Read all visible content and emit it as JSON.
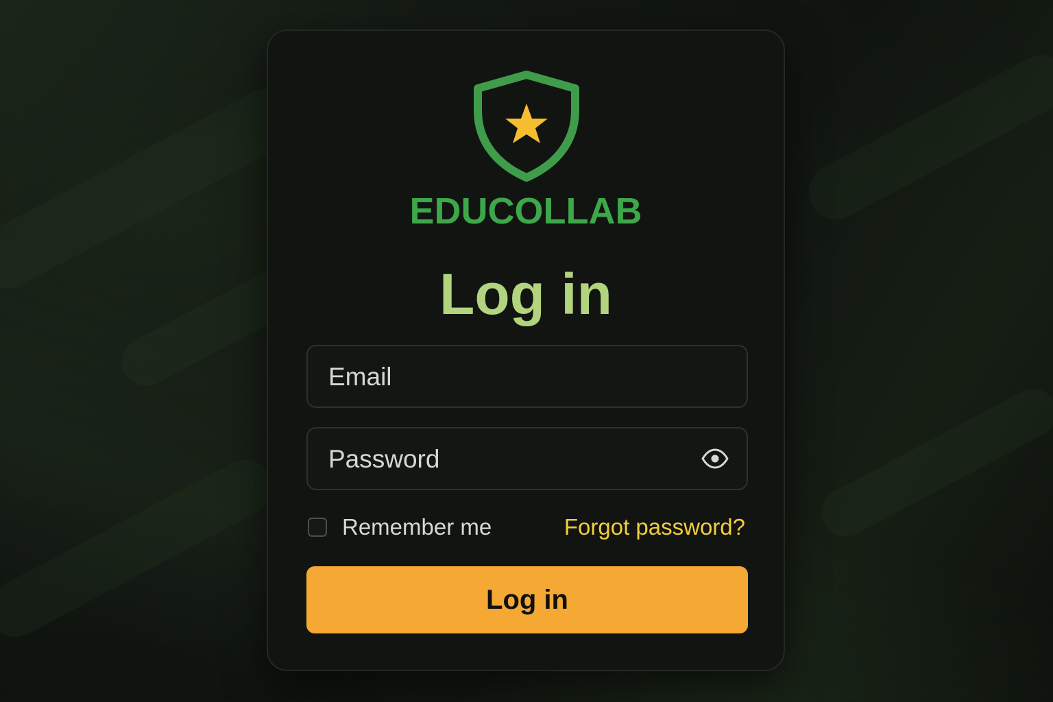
{
  "brand": {
    "name": "EDUCOLLAB",
    "logo_icon": "shield-star-icon",
    "colors": {
      "shield": "#3f9c4a",
      "star": "#f6be2f",
      "brand_text": "#3da749"
    }
  },
  "form": {
    "title": "Log in",
    "email": {
      "placeholder": "Email",
      "value": ""
    },
    "password": {
      "placeholder": "Password",
      "value": "",
      "toggle_icon": "eye-icon"
    },
    "remember_me": {
      "label": "Remember me",
      "checked": false
    },
    "forgot_password_label": "Forgot password?",
    "submit_label": "Log in"
  },
  "theme": {
    "title_color": "#b2d47f",
    "link_color": "#f2cd3e",
    "button_color": "#f5a833",
    "card_background": "#121412"
  }
}
